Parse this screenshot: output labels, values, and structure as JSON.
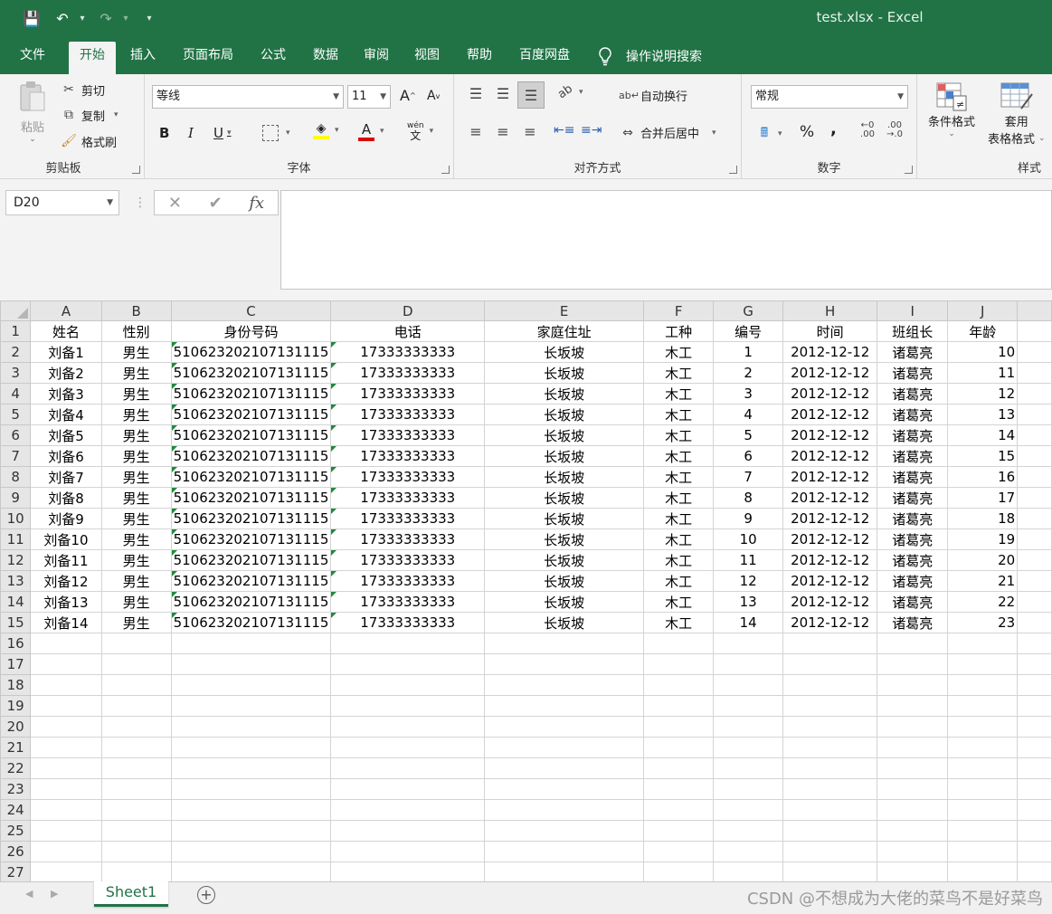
{
  "window": {
    "title": "test.xlsx  -  Excel"
  },
  "colors": {
    "accent": "#217346",
    "ribbon_bg": "#f3f3f3",
    "header_bg": "#e6e6e6",
    "gridline": "#d4d4d4",
    "triangle": "#1f8a3c"
  },
  "quick_access": {
    "save": "💾",
    "undo": "↶",
    "redo": "↷",
    "more": "▾"
  },
  "tabs": [
    "文件",
    "开始",
    "插入",
    "页面布局",
    "公式",
    "数据",
    "审阅",
    "视图",
    "帮助",
    "百度网盘"
  ],
  "tell_me": "操作说明搜索",
  "ribbon": {
    "clipboard": {
      "label": "剪贴板",
      "paste": "粘贴",
      "cut": "剪切",
      "copy": "复制",
      "format_painter": "格式刷"
    },
    "font": {
      "label": "字体",
      "font_name": "等线",
      "font_size": "11",
      "grow": "A",
      "shrink": "A",
      "bold": "B",
      "italic": "I",
      "underline": "U",
      "font_color": "A",
      "phonetic": "文"
    },
    "alignment": {
      "label": "对齐方式",
      "wrap_text": "自动换行",
      "merge_center": "合并后居中"
    },
    "number": {
      "label": "数字",
      "format": "常规",
      "percent": "%",
      "comma": ","
    },
    "styles": {
      "label": "样式",
      "conditional": "条件格式",
      "table_line1": "套用",
      "table_line2": "表格格式"
    }
  },
  "formula_bar": {
    "name_box": "D20",
    "cancel": "✕",
    "enter": "✔",
    "fx": "fx",
    "content": ""
  },
  "grid": {
    "columns": [
      "A",
      "B",
      "C",
      "D",
      "E",
      "F",
      "G",
      "H",
      "I",
      "J"
    ],
    "header_row": [
      "姓名",
      "性别",
      "身份号码",
      "电话",
      "家庭住址",
      "工种",
      "编号",
      "时间",
      "班组长",
      "年龄"
    ],
    "rows": [
      [
        "刘备1",
        "男生",
        "510623202107131115",
        "17333333333",
        "长坂坡",
        "木工",
        "1",
        "2012-12-12",
        "诸葛亮",
        "10"
      ],
      [
        "刘备2",
        "男生",
        "510623202107131115",
        "17333333333",
        "长坂坡",
        "木工",
        "2",
        "2012-12-12",
        "诸葛亮",
        "11"
      ],
      [
        "刘备3",
        "男生",
        "510623202107131115",
        "17333333333",
        "长坂坡",
        "木工",
        "3",
        "2012-12-12",
        "诸葛亮",
        "12"
      ],
      [
        "刘备4",
        "男生",
        "510623202107131115",
        "17333333333",
        "长坂坡",
        "木工",
        "4",
        "2012-12-12",
        "诸葛亮",
        "13"
      ],
      [
        "刘备5",
        "男生",
        "510623202107131115",
        "17333333333",
        "长坂坡",
        "木工",
        "5",
        "2012-12-12",
        "诸葛亮",
        "14"
      ],
      [
        "刘备6",
        "男生",
        "510623202107131115",
        "17333333333",
        "长坂坡",
        "木工",
        "6",
        "2012-12-12",
        "诸葛亮",
        "15"
      ],
      [
        "刘备7",
        "男生",
        "510623202107131115",
        "17333333333",
        "长坂坡",
        "木工",
        "7",
        "2012-12-12",
        "诸葛亮",
        "16"
      ],
      [
        "刘备8",
        "男生",
        "510623202107131115",
        "17333333333",
        "长坂坡",
        "木工",
        "8",
        "2012-12-12",
        "诸葛亮",
        "17"
      ],
      [
        "刘备9",
        "男生",
        "510623202107131115",
        "17333333333",
        "长坂坡",
        "木工",
        "9",
        "2012-12-12",
        "诸葛亮",
        "18"
      ],
      [
        "刘备10",
        "男生",
        "510623202107131115",
        "17333333333",
        "长坂坡",
        "木工",
        "10",
        "2012-12-12",
        "诸葛亮",
        "19"
      ],
      [
        "刘备11",
        "男生",
        "510623202107131115",
        "17333333333",
        "长坂坡",
        "木工",
        "11",
        "2012-12-12",
        "诸葛亮",
        "20"
      ],
      [
        "刘备12",
        "男生",
        "510623202107131115",
        "17333333333",
        "长坂坡",
        "木工",
        "12",
        "2012-12-12",
        "诸葛亮",
        "21"
      ],
      [
        "刘备13",
        "男生",
        "510623202107131115",
        "17333333333",
        "长坂坡",
        "木工",
        "13",
        "2012-12-12",
        "诸葛亮",
        "22"
      ],
      [
        "刘备14",
        "男生",
        "510623202107131115",
        "17333333333",
        "长坂坡",
        "木工",
        "14",
        "2012-12-12",
        "诸葛亮",
        "23"
      ]
    ],
    "total_visible_rows": 27
  },
  "sheet_tabs": {
    "active": "Sheet1",
    "add": "+"
  },
  "watermark": "CSDN @不想成为大佬的菜鸟不是好菜鸟"
}
